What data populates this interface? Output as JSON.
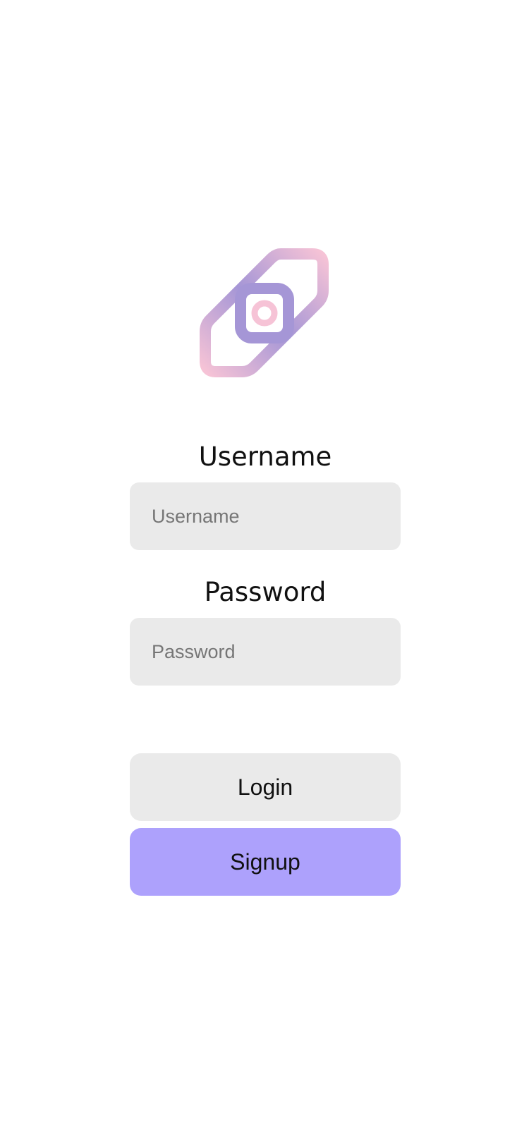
{
  "logo": {
    "icon": "link-chain-logo-icon",
    "colors": {
      "pink": "#f6c3d6",
      "purple": "#a596d6"
    }
  },
  "form": {
    "username": {
      "label": "Username",
      "placeholder": "Username",
      "value": ""
    },
    "password": {
      "label": "Password",
      "placeholder": "Password",
      "value": ""
    }
  },
  "actions": {
    "login_label": "Login",
    "signup_label": "Signup"
  },
  "colors": {
    "field_bg": "#eaeaea",
    "signup_bg": "#ada1fc"
  }
}
